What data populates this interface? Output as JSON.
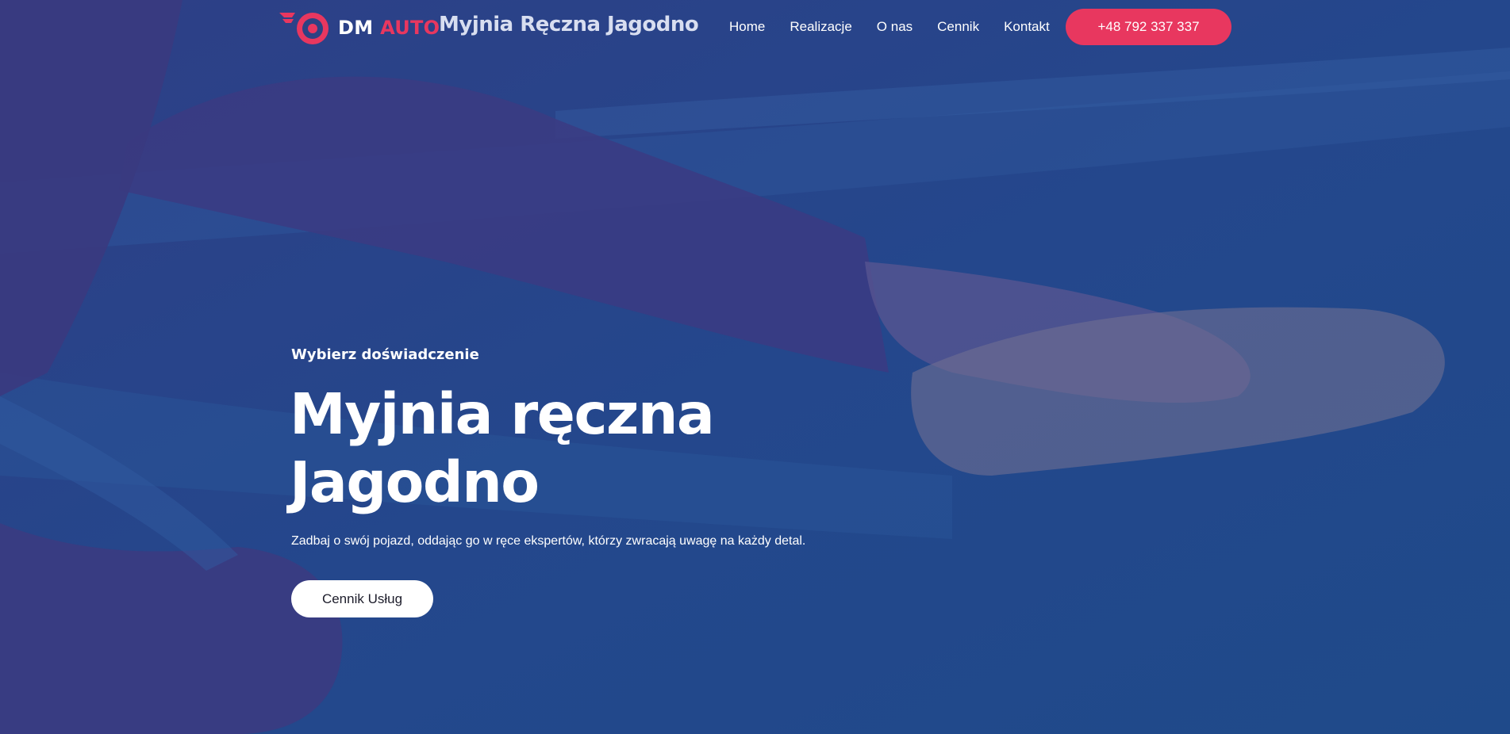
{
  "brand": {
    "logo_dm": "DM",
    "logo_auto": "AUTO",
    "site_name": "Myjnia Ręczna Jagodno",
    "accent_color": "#e8375f",
    "overlay_color": "#24407f"
  },
  "nav": {
    "items": [
      {
        "label": "Home"
      },
      {
        "label": "Realizacje"
      },
      {
        "label": "O nas"
      },
      {
        "label": "Cennik"
      },
      {
        "label": "Kontakt"
      }
    ],
    "phone_label": "+48 792 337 337"
  },
  "hero": {
    "kicker": "Wybierz doświadczenie",
    "title_line1": "Myjnia ręczna",
    "title_line2": "Jagodno",
    "subtitle": "Zadbaj o swój pojazd, oddając go w ręce ekspertów, którzy zwracają uwagę na każdy detal.",
    "cta_label": "Cennik Usług",
    "background_image": "car-washing-hands-photo"
  }
}
